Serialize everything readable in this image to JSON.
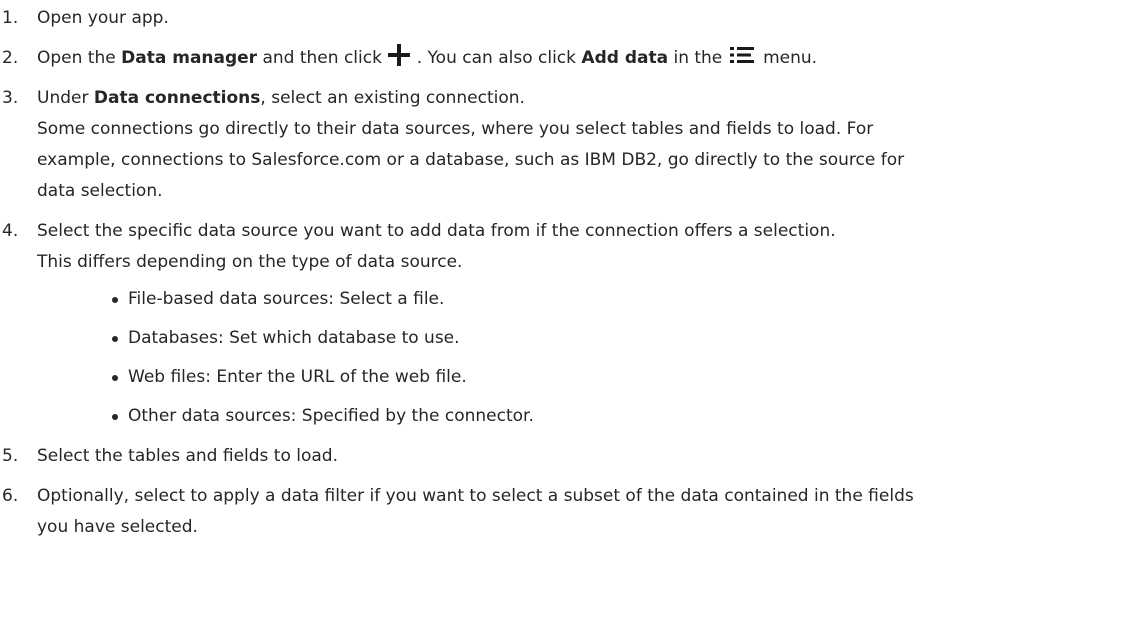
{
  "steps": [
    {
      "number": "1.",
      "text": "Open your app."
    },
    {
      "number": "2.",
      "pre": "Open the ",
      "bold1": "Data manager",
      "mid1": " and then click ",
      "mid2": " . You can also click ",
      "bold2": "Add data",
      "mid3": " in the ",
      "post": " menu."
    },
    {
      "number": "3.",
      "pre": "Under ",
      "bold": "Data connections",
      "post": ", select an existing connection.",
      "detail1": "Some connections go directly to their data sources, where you select tables and fields to load. For",
      "detail2": "example, connections to Salesforce.com or a database, such as IBM DB2, go directly to the source for",
      "detail3": "data selection."
    },
    {
      "number": "4.",
      "text": "Select the specific data source you want to add data from if the connection offers a selection.",
      "detail": "This differs depending on the type of data source.",
      "bullets": [
        "File-based data sources: Select a file.",
        "Databases: Set which database to use.",
        "Web files: Enter the URL of the web file.",
        "Other data sources: Specified by the connector."
      ]
    },
    {
      "number": "5.",
      "text": "Select the tables and fields to load."
    },
    {
      "number": "6.",
      "line1": "Optionally, select to apply a data filter if you want to select a subset of the data contained in the fields",
      "line2": "you have selected."
    }
  ],
  "icons": {
    "add": "plus-icon",
    "menu": "list-menu-icon"
  }
}
